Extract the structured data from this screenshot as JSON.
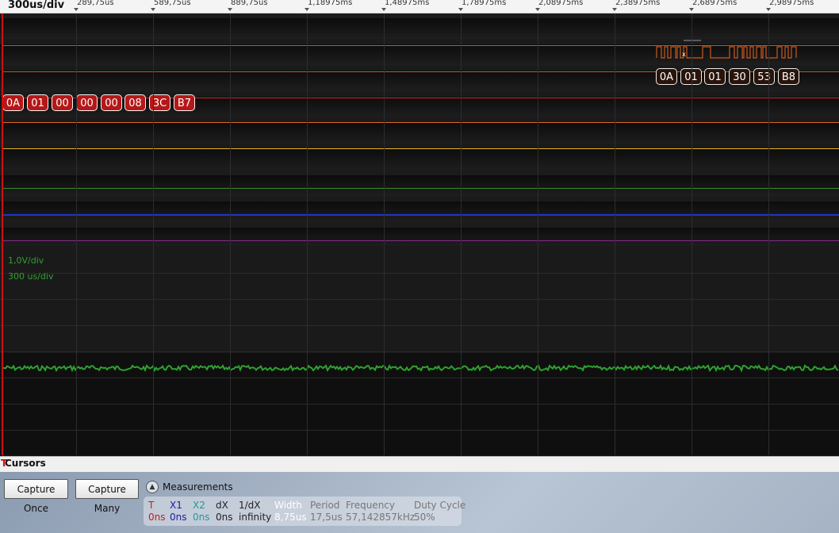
{
  "scope": {
    "timebase": "300us/div",
    "ticks": [
      "289,75us",
      "589,75us",
      "889,75us",
      "1,18975ms",
      "1,48975ms",
      "1,78975ms",
      "2,08975ms",
      "2,38975ms",
      "2,68975ms",
      "2,98975ms"
    ],
    "analog": {
      "volts_per_div": "1,0V/div",
      "time_per_div": "300 us/div"
    }
  },
  "decoded": {
    "tx_bytes": [
      "0A",
      "01",
      "00",
      "00",
      "00",
      "08",
      "3C",
      "B7"
    ],
    "rx_bytes": [
      "0A",
      "01",
      "01",
      "30",
      "53",
      "B8"
    ]
  },
  "cursors": {
    "title": "Cursors",
    "t_marker": "T"
  },
  "controls": {
    "capture_once": "Capture Once",
    "capture_many": "Capture Many",
    "measurements_label": "Measurements"
  },
  "measurements": [
    {
      "header": "T",
      "value": "0ns",
      "color": "#c0211f"
    },
    {
      "header": "X1",
      "value": "0ns",
      "color": "#1a1aa8"
    },
    {
      "header": "X2",
      "value": "0ns",
      "color": "#1a9b9b"
    },
    {
      "header": "dX",
      "value": "0ns",
      "color": "#222222"
    },
    {
      "header": "1/dX",
      "value": "infinity",
      "color": "#222222"
    },
    {
      "header": "Width",
      "value": "8,75us",
      "color": "#ffffff"
    },
    {
      "header": "Period",
      "value": "17,5us",
      "color": "#777777"
    },
    {
      "header": "Frequency",
      "value": "57,142857kHz",
      "color": "#777777"
    },
    {
      "header": "Duty Cycle",
      "value": "50%",
      "color": "#777777"
    }
  ],
  "colors": {
    "trigger": "#cc1111",
    "ch_orange": "#d2691e",
    "ch_red": "#e52020",
    "ch_yellow": "#e6b422",
    "ch_green": "#3a8a2a",
    "ch_blue": "#2233cc",
    "ch_purple": "#8a2a8a",
    "analog_trace": "#2ea12e"
  }
}
